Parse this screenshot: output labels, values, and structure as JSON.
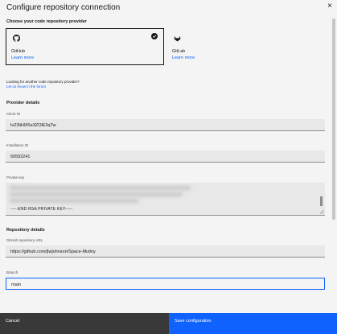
{
  "header": {
    "title": "Configure repository connection",
    "close_glyph": "×"
  },
  "provider": {
    "section_label": "Choose your code repository provider",
    "tiles": [
      {
        "name": "GitHub",
        "link": "Learn more",
        "icon": "github-icon",
        "selected": true
      },
      {
        "name": "GitLab",
        "link": "Learn more",
        "icon": "gitlab-icon",
        "selected": false
      }
    ],
    "helper_text": "Looking for another code repository provider?",
    "helper_link": "Let us know in the forum"
  },
  "provider_details": {
    "section_label": "Provider details",
    "client_id_label": "Client ID",
    "client_id_value": "Iv23liH0lSe3ZOlE3qTw",
    "installation_id_label": "Installation ID",
    "installation_id_value": "60592241",
    "private_key_label": "Private key",
    "private_key_tail": "-----END RSA PRIVATE KEY-----"
  },
  "repository_details": {
    "section_label": "Repository details",
    "url_label": "GitHub repository URL",
    "url_value": "https://github.com/jlwjohnson/Space-Mutiny",
    "branch_label": "Branch",
    "branch_value": "main"
  },
  "footer": {
    "cancel_label": "Cancel",
    "save_label": "Save configuration"
  },
  "colors": {
    "accent": "#0f62fe",
    "cancel_bg": "#393939",
    "modal_bg": "#f4f4f4"
  }
}
